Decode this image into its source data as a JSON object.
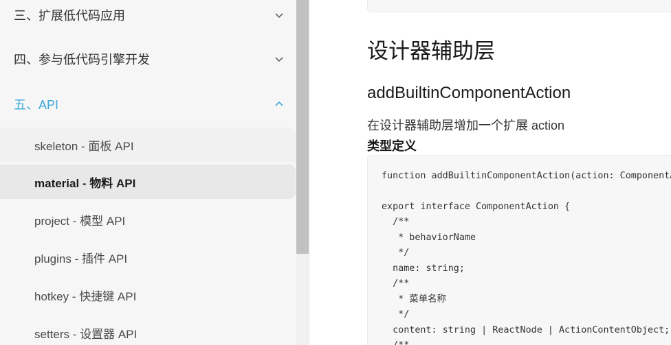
{
  "sidebar": {
    "sections": [
      {
        "label": "三、扩展低代码应用",
        "expanded": false
      },
      {
        "label": "四、参与低代码引擎开发",
        "expanded": false
      },
      {
        "label": "五、API",
        "expanded": true
      }
    ],
    "items": [
      {
        "label": "skeleton - 面板 API"
      },
      {
        "label": "material - 物料 API",
        "selected": true
      },
      {
        "label": "project - 模型 API"
      },
      {
        "label": "plugins - 插件 API"
      },
      {
        "label": "hotkey - 快捷键 API"
      },
      {
        "label": "setters - 设置器 API"
      }
    ],
    "active_color": "#3eaadb"
  },
  "main": {
    "heading": "设计器辅助层",
    "subheading": "addBuiltinComponentAction",
    "description": "在设计器辅助层增加一个扩展 action",
    "type_def_label": "类型定义",
    "code_lines": [
      "function addBuiltinComponentAction(action: ComponentAction): void;",
      "",
      "export interface ComponentAction {",
      "  /**",
      "   * behaviorName",
      "   */",
      "  name: string;",
      "  /**",
      "   * 菜单名称",
      "   */",
      "  content: string | ReactNode | ActionContentObject;",
      "  /**"
    ]
  }
}
